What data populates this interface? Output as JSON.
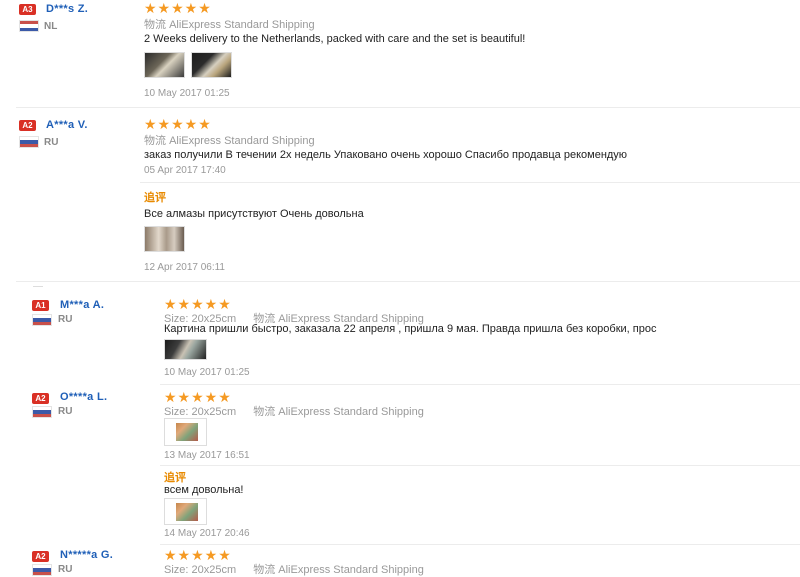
{
  "colors": {
    "badge": "#d93025",
    "star": "#f59a23",
    "name": "#1f5fb7",
    "followup": "#e88a00"
  },
  "icons": {
    "star": "★",
    "flag_nl": "flag-nl-icon",
    "flag_ru": "flag-ru-icon"
  },
  "reviews": [
    {
      "level": "A3",
      "name": "D***s Z.",
      "country": "NL",
      "stars": "★★★★★",
      "shipping_label": "物流",
      "shipping": "AliExpress Standard Shipping",
      "text": "2 Weeks delivery to the Netherlands, packed with care and the set is beautiful!",
      "date": "10 May 2017 01:25"
    },
    {
      "level": "A2",
      "name": "A***a V.",
      "country": "RU",
      "stars": "★★★★★",
      "shipping_label": "物流",
      "shipping": "AliExpress Standard Shipping",
      "text": "заказ получили В течении 2х недель Упаковано очень хорошо Спасибо продавца рекомендую",
      "date": "05 Apr 2017 17:40",
      "followup_label": "追评",
      "followup_text": "Все алмазы присутствуют Очень довольна",
      "followup_date": "12 Apr 2017 06:11"
    },
    {
      "level": "A1",
      "name": "M***a A.",
      "country": "RU",
      "stars": "★★★★★",
      "size": "Size: 20x25cm",
      "shipping_label": "物流",
      "shipping": "AliExpress Standard Shipping",
      "text": "Картина пришли быстро, заказала 22 апреля , пришла 9 мая. Правда пришла без коробки, прос",
      "date": "10 May 2017 01:25"
    },
    {
      "level": "A2",
      "name": "O****a L.",
      "country": "RU",
      "stars": "★★★★★",
      "size": "Size: 20x25cm",
      "shipping_label": "物流",
      "shipping": "AliExpress Standard Shipping",
      "date": "13 May 2017 16:51",
      "followup_label": "追评",
      "followup_text": "всем довольна!",
      "followup_date": "14 May 2017 20:46"
    },
    {
      "level": "A2",
      "name": "N*****a G.",
      "country": "RU",
      "stars": "★★★★★",
      "size": "Size: 20x25cm",
      "shipping_label": "物流",
      "shipping": "AliExpress Standard Shipping"
    }
  ]
}
